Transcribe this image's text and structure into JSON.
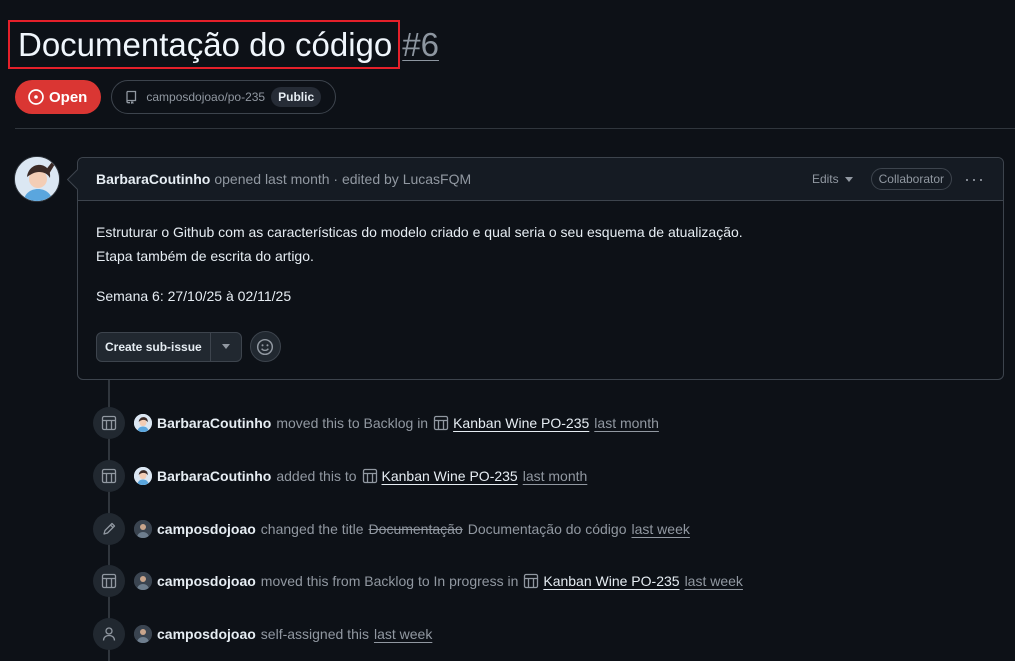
{
  "issue": {
    "title": "Documentação do código",
    "number": "#6",
    "state_label": "Open",
    "repo": "camposdojoao/po-235",
    "visibility": "Public"
  },
  "comment": {
    "author": "BarbaraCoutinho",
    "meta": "opened last month · edited by LucasFQM",
    "edits_label": "Edits",
    "role_badge": "Collaborator",
    "body_line1": "Estruturar o Github com as características do modelo criado e qual seria o seu esquema de atualização.",
    "body_line2": "Etapa também de escrita do artigo.",
    "body_line3": "Semana 6: 27/10/25 à 02/11/25",
    "subissue_label": "Create sub-issue"
  },
  "events": [
    {
      "actor": "BarbaraCoutinho",
      "text": "moved this to Backlog in",
      "project": "Kanban Wine PO-235",
      "time": "last month",
      "icon": "project-icon"
    },
    {
      "actor": "BarbaraCoutinho",
      "text": "added this to",
      "project": "Kanban Wine PO-235",
      "time": "last month",
      "icon": "project-icon"
    },
    {
      "actor": "camposdojoao",
      "text": "changed the title",
      "old_title": "Documentação",
      "new_title": "Documentação do código",
      "time": "last week",
      "icon": "pencil-icon"
    },
    {
      "actor": "camposdojoao",
      "text": "moved this from Backlog to In progress in",
      "project": "Kanban Wine PO-235",
      "time": "last week",
      "icon": "project-icon"
    },
    {
      "actor": "camposdojoao",
      "text": "self-assigned this",
      "time": "last week",
      "icon": "person-icon"
    }
  ],
  "colors": {
    "background": "#0d1117",
    "open_badge": "#da3633",
    "highlight_box": "#e5202a",
    "muted_text": "#9198a1"
  }
}
